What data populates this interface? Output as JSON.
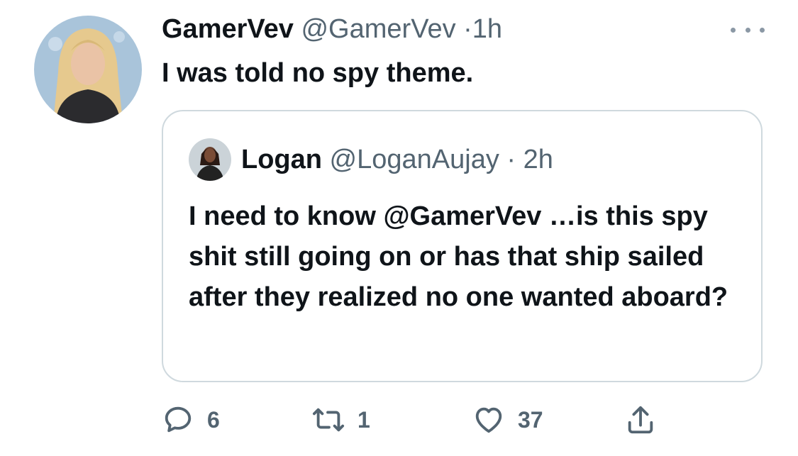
{
  "tweet": {
    "display_name": "GamerVev",
    "handle": "@GamerVev",
    "separator": "·",
    "time": "1h",
    "text": "I was told no spy theme."
  },
  "quoted_tweet": {
    "display_name": "Logan",
    "handle": "@LoganAujay",
    "separator": "·",
    "time": "2h",
    "text": "I need to know @GamerVev …is this spy shit still going on or has that ship sailed after they realized no one wanted aboard?"
  },
  "actions": {
    "reply_count": "6",
    "retweet_count": "1",
    "like_count": "37"
  },
  "icons": {
    "more": "more-dots-icon",
    "reply": "reply-bubble-icon",
    "retweet": "retweet-icon",
    "like": "heart-icon",
    "share": "share-icon"
  },
  "colors": {
    "text_primary": "#0f1419",
    "text_secondary": "#536471",
    "border": "#cfd9de",
    "more_dots": "#8b98a5"
  }
}
